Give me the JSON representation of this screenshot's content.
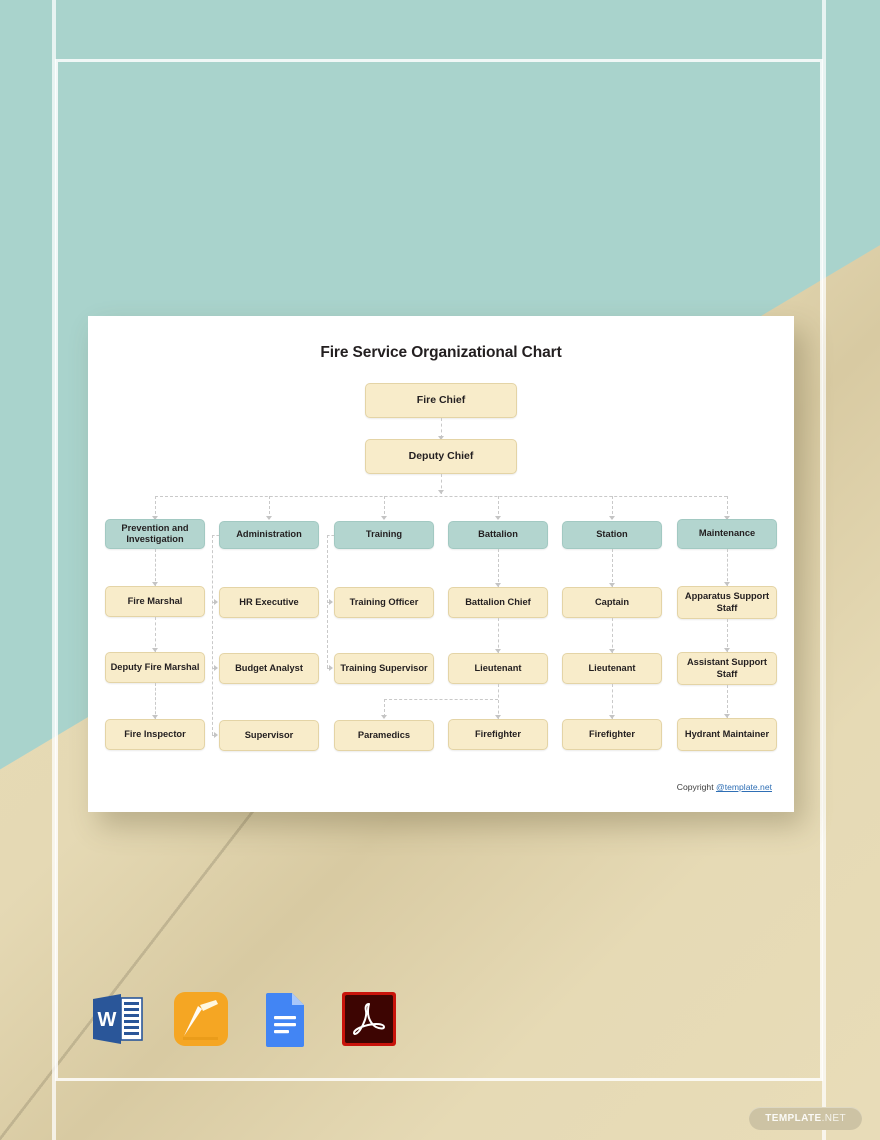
{
  "document": {
    "chart_title": "Fire Service Organizational Chart",
    "copyright_prefix": "Copyright ",
    "copyright_link": "@template.net"
  },
  "brand": {
    "pill_main": "TEMPLATE",
    "pill_suffix": ".NET"
  },
  "colors": {
    "page_teal": "#a9d3cc",
    "page_beige": "#e8dcb8",
    "card_white": "#ffffff",
    "node_cream": "#f8ecca",
    "node_cream_border": "#e4d4a6",
    "node_teal": "#b3d5cf",
    "node_teal_border": "#a2c9c2",
    "connector_gray": "#c9c9c9",
    "link_blue": "#2f6fb5",
    "title_black": "#231f20"
  },
  "file_formats": [
    {
      "name": "ms-word",
      "label": "MS Word"
    },
    {
      "name": "apple-pages",
      "label": "Apple Pages"
    },
    {
      "name": "google-docs",
      "label": "Google Docs"
    },
    {
      "name": "pdf",
      "label": "PDF"
    }
  ],
  "chart_data": {
    "type": "diagram",
    "title": "Fire Service Organizational Chart",
    "orientation": "top-down",
    "levels": 6,
    "top_nodes": [
      {
        "id": "fire-chief",
        "label": "Fire Chief",
        "style": "cream",
        "level": 0
      },
      {
        "id": "deputy-chief",
        "label": "Deputy Chief",
        "style": "cream",
        "level": 1
      }
    ],
    "columns": [
      {
        "id": "prevention-and-investigation",
        "head": "Prevention and Investigation",
        "head_style": "teal",
        "connector": "vertical",
        "nodes": [
          "Fire Marshal",
          "Deputy Fire Marshal",
          "Fire Inspector"
        ]
      },
      {
        "id": "administration",
        "head": "Administration",
        "head_style": "teal",
        "connector": "elbow-left",
        "nodes": [
          "HR Executive",
          "Budget Analyst",
          "Supervisor"
        ]
      },
      {
        "id": "training",
        "head": "Training",
        "head_style": "teal",
        "connector": "elbow-left",
        "nodes": [
          "Training Officer",
          "Training Supervisor",
          "Paramedics"
        ]
      },
      {
        "id": "battalion",
        "head": "Battalion",
        "head_style": "teal",
        "connector": "vertical",
        "nodes": [
          "Battalion Chief",
          "Lieutenant",
          "Firefighter"
        ]
      },
      {
        "id": "station",
        "head": "Station",
        "head_style": "teal",
        "connector": "vertical",
        "nodes": [
          "Captain",
          "Lieutenant",
          "Firefighter"
        ]
      },
      {
        "id": "maintenance",
        "head": "Maintenance",
        "head_style": "teal",
        "connector": "vertical",
        "nodes": [
          "Apparatus Support Staff",
          "Assistant Support Staff",
          "Hydrant Maintainer"
        ]
      }
    ],
    "extra_links": [
      {
        "from": "battalion.Lieutenant",
        "to": "training.Paramedics",
        "style": "dashed-elbow"
      }
    ]
  }
}
